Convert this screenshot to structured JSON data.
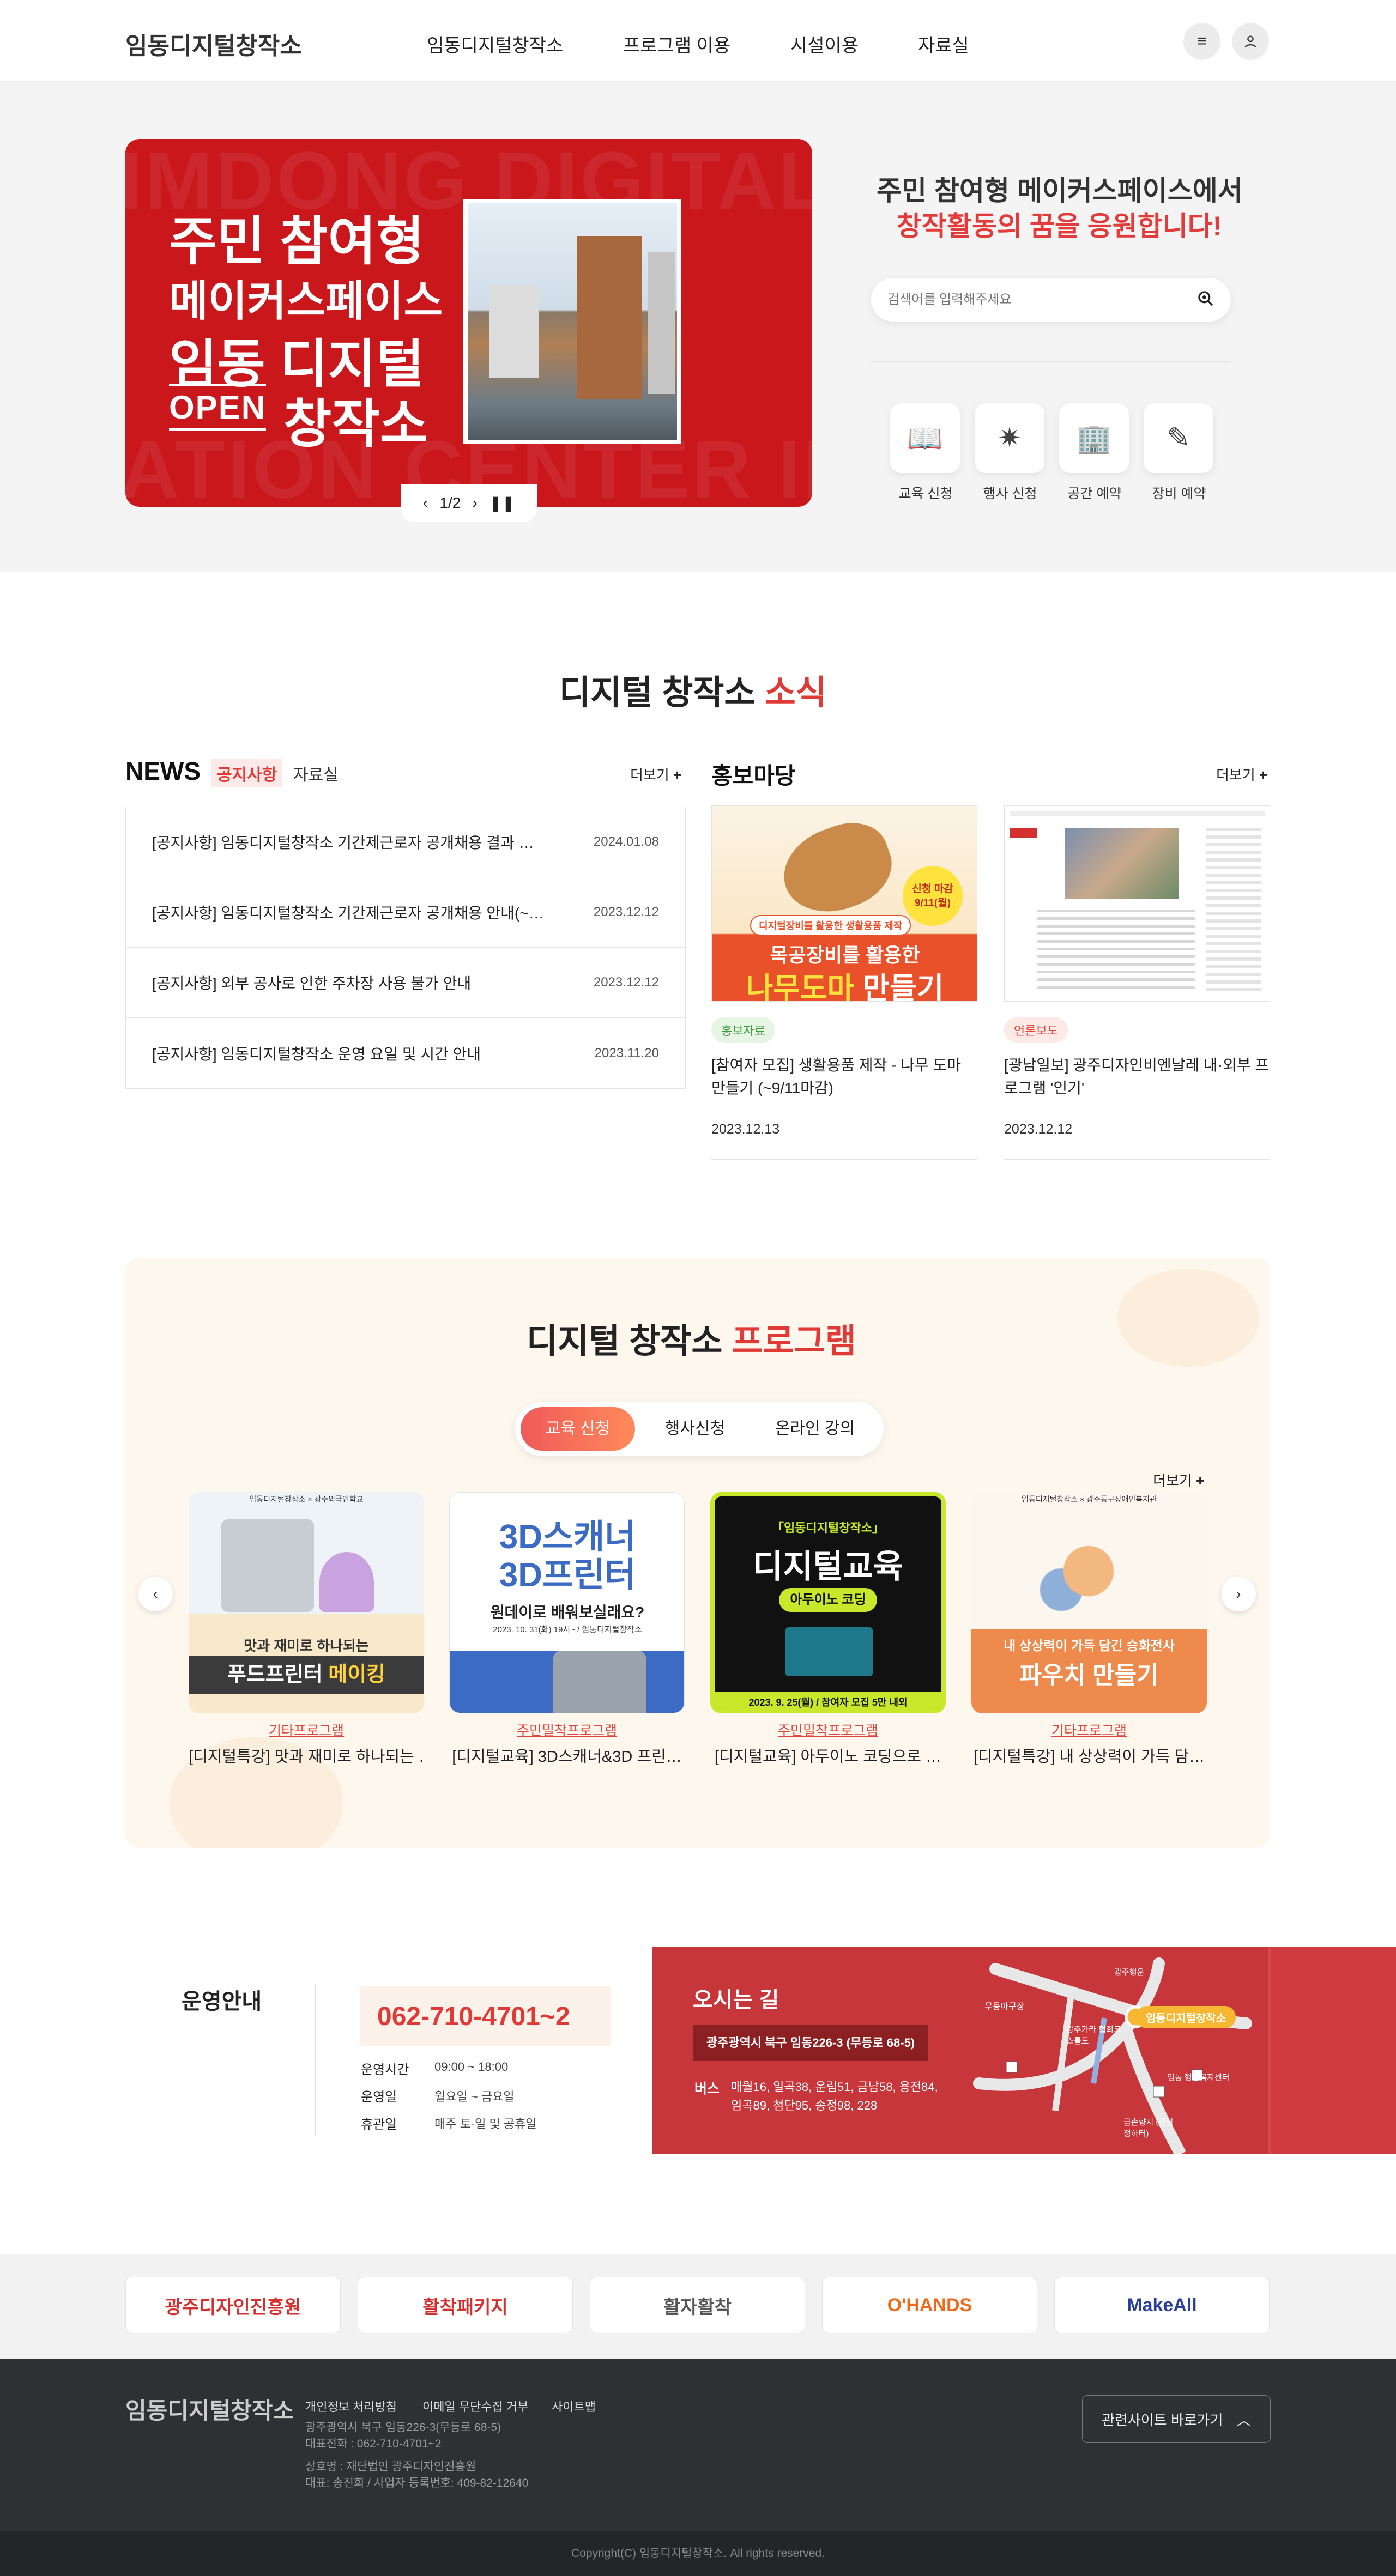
{
  "header": {
    "logo": "임동디지털창작소",
    "nav": [
      "임동디지털창작소",
      "프로그램 이용",
      "시설이용",
      "자료실"
    ],
    "icons": [
      "menu-icon",
      "user-icon"
    ]
  },
  "hero": {
    "banner": {
      "line1": "주민 참여형",
      "line2": "메이커스페이스",
      "line3": "임동 디지털",
      "line4_badge": "OPEN",
      "line4_text": "창작소",
      "bg_text_top": "IMDONG DIGITAL CRE",
      "bg_text_bottom": "ATION CENTER IMDON",
      "counter": "1/2"
    },
    "slogan_line1": "주민 참여형 메이커스페이스에서",
    "slogan_line2": "창작활동의 꿈을 응원합니다!",
    "search_placeholder": "검색어를 입력해주세요",
    "quick_links": [
      {
        "label": "교육 신청",
        "icon": "book-icon"
      },
      {
        "label": "행사 신청",
        "icon": "sparkle-icon"
      },
      {
        "label": "공간 예약",
        "icon": "building-icon"
      },
      {
        "label": "장비 예약",
        "icon": "equipment-icon"
      }
    ]
  },
  "news_section": {
    "title_main": "디지털 창작소",
    "title_accent": "소식",
    "news_title": "NEWS",
    "tab_active": "공지사항",
    "tab_other": "자료실",
    "more": "더보기",
    "items": [
      {
        "title": "[공지사항] 임동디지털창작소 기간제근로자 공개채용 결과 …",
        "date": "2024.01.08"
      },
      {
        "title": "[공지사항] 임동디지털창작소 기간제근로자 공개채용 안내(~…",
        "date": "2023.12.12"
      },
      {
        "title": "[공지사항] 외부 공사로 인한 주차장 사용 불가 안내",
        "date": "2023.12.12"
      },
      {
        "title": "[공지사항] 임동디지털창작소 운영 요일 및 시간 안내",
        "date": "2023.11.20"
      }
    ],
    "promo_title": "홍보마당",
    "promo_more": "더보기",
    "promo_cards": [
      {
        "tag": "홍보자료",
        "title": "[참여자 모집] 생활용품 제작 - 나무 도마 만들기 (~9/11마감)",
        "date": "2023.12.13",
        "img_sub": "디지털장비를 활용한 생활용품 제작",
        "img_line1": "목공장비를 활용한",
        "img_line2a": "나무도마",
        "img_line2b": " 만들기",
        "img_badge1": "신청 마감",
        "img_badge2": "9/11(월)"
      },
      {
        "tag": "언론보도",
        "title": "[광남일보] 광주디자인비엔날레 내·외부 프로그램 '인기'",
        "date": "2023.12.12"
      }
    ]
  },
  "program_section": {
    "title_main": "디지털 창작소",
    "title_accent": "프로그램",
    "tabs": [
      "교육 신청",
      "행사신청",
      "온라인 강의"
    ],
    "more": "더보기",
    "cards": [
      {
        "category": "기타프로그램",
        "title": "[디지털특강] 맛과 재미로 하나되는 …",
        "img_line1": "맛과 재미로 하나되는",
        "img_line2a": "푸드프린터 ",
        "img_line2b": "메이킹",
        "img_top": "임동디지털창작소 × 광주외국인학교"
      },
      {
        "category": "주민밀착프로그램",
        "title": "[디지털교육] 3D스캐너&3D 프린…",
        "img_line1": "3D스캐너",
        "img_line2": "3D프린터",
        "img_line3": "원데이로 배워보실래요?",
        "img_line4": "2023. 10. 31(화) 19시~ / 임동디지털창작소"
      },
      {
        "category": "주민밀착프로그램",
        "title": "[디지털교육] 아두이노 코딩으로 …",
        "img_line1": "「임동디지털창작소」",
        "img_line2": "디지털교육",
        "img_line3": "아두이노 코딩",
        "img_line4": "2023. 9. 25(월) / 참여자 모집 5만 내외"
      },
      {
        "category": "기타프로그램",
        "title": "[디지털특강] 내 상상력이 가득 담…",
        "img_line1": "내 상상력이 가득 담긴 승화전사",
        "img_line2": "파우치 만들기",
        "img_top": "임동디지털창작소 × 광주동구장애인복지관"
      }
    ]
  },
  "info": {
    "title": "운영안내",
    "phone": "062-710-4701~2",
    "rows": [
      {
        "label": "운영시간",
        "value": "09:00 ~ 18:00"
      },
      {
        "label": "운영일",
        "value": "월요일 ~ 금요일"
      },
      {
        "label": "휴관일",
        "value": "매주 토·일 및 공휴일"
      }
    ],
    "map_title": "오시는 길",
    "address": "광주광역시 북구 임동226-3 (무등로 68-5)",
    "bus_label": "버스",
    "bus_line1": "매월16, 일곡38, 운림51, 금남58, 용전84,",
    "bus_line2": "임곡89, 첨단95, 송정98, 228",
    "map_pin": "임동디지털창작소",
    "map_places": [
      "무등아구장",
      "광주가라 협회코스톨도",
      "임동 행동복지센터",
      "광주행운",
      "금손향지 (긴남정하터)"
    ]
  },
  "partners": [
    "광주디자인진흥원",
    "활착패키지",
    "활자활착",
    "O'HANDS",
    "MakeAll"
  ],
  "footer": {
    "logo": "임동디지털창작소",
    "links": [
      "개인정보 처리방침",
      "이메일 무단수집 거부",
      "사이트맵"
    ],
    "address": "광주광역시 북구 임동226-3(무등로 68-5)",
    "tel": "대표전화 : 062-710-4701~2",
    "company": "상호명 : 재단법인 광주디자인진흥원",
    "ceo": "대표: 송진희 / 사업자 등록번호: 409-82-12640",
    "family_site": "관련사이트 바로가기",
    "copyright": "Copyright(C) 임동디지털창작소. All rights reserved."
  },
  "colors": {
    "brand_red": "#e03a37",
    "banner_red": "#c9171c",
    "footer_dark": "#2f3033",
    "program_bg": "#fdf7ee"
  }
}
